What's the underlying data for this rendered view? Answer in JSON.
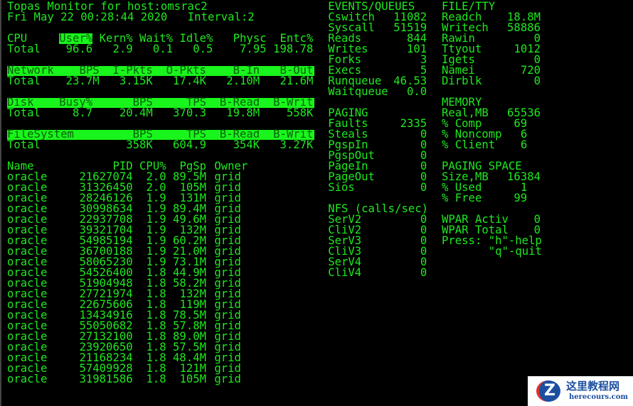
{
  "header": {
    "title": "Topas Monitor for host:omsrac2",
    "datetime": "Fri May 22 00:28:44 2020",
    "interval": "Interval:2"
  },
  "cpu": {
    "label": "CPU",
    "headers": [
      "User%",
      "Kern%",
      "Wait%",
      "Idle%",
      "Physc",
      "Entc%"
    ],
    "total_label": "Total",
    "values": [
      "96.6",
      "2.9",
      "0.1",
      "0.5",
      "7.95",
      "198.78"
    ]
  },
  "network": {
    "label": "Network",
    "headers": [
      "BPS",
      "I-Pkts",
      "O-Pkts",
      "B-In",
      "B-Out"
    ],
    "total_label": "Total",
    "values": [
      "23.7M",
      "3.15K",
      "17.4K",
      "2.10M",
      "21.6M"
    ]
  },
  "disk": {
    "label": "Disk",
    "headers": [
      "Busy%",
      "BPS",
      "TPS",
      "B-Read",
      "B-Writ"
    ],
    "total_label": "Total",
    "values": [
      "8.7",
      "20.4M",
      "370.3",
      "19.8M",
      "558K"
    ]
  },
  "filesystem": {
    "label": "FileSystem",
    "headers": [
      "BPS",
      "TPS",
      "B-Read",
      "B-Writ"
    ],
    "total_label": "Total",
    "values": [
      "358K",
      "604.9",
      "354K",
      "3.27K"
    ]
  },
  "processes": {
    "headers": [
      "Name",
      "PID",
      "CPU%",
      "PgSp",
      "Owner"
    ],
    "rows": [
      [
        "oracle",
        "21627074",
        "2.0",
        "89.5M",
        "grid"
      ],
      [
        "oracle",
        "31326450",
        "2.0",
        "105M",
        "grid"
      ],
      [
        "oracle",
        "28246126",
        "1.9",
        "131M",
        "grid"
      ],
      [
        "oracle",
        "30998634",
        "1.9",
        "89.4M",
        "grid"
      ],
      [
        "oracle",
        "22937708",
        "1.9",
        "49.6M",
        "grid"
      ],
      [
        "oracle",
        "39321704",
        "1.9",
        "132M",
        "grid"
      ],
      [
        "oracle",
        "54985194",
        "1.9",
        "60.2M",
        "grid"
      ],
      [
        "oracle",
        "36700188",
        "1.9",
        "21.0M",
        "grid"
      ],
      [
        "oracle",
        "58065230",
        "1.9",
        "73.1M",
        "grid"
      ],
      [
        "oracle",
        "54526400",
        "1.8",
        "44.9M",
        "grid"
      ],
      [
        "oracle",
        "51904948",
        "1.8",
        "58.2M",
        "grid"
      ],
      [
        "oracle",
        "27721974",
        "1.8",
        "132M",
        "grid"
      ],
      [
        "oracle",
        "22675606",
        "1.8",
        "119M",
        "grid"
      ],
      [
        "oracle",
        "13434916",
        "1.8",
        "78.5M",
        "grid"
      ],
      [
        "oracle",
        "55050682",
        "1.8",
        "57.8M",
        "grid"
      ],
      [
        "oracle",
        "27132100",
        "1.8",
        "89.0M",
        "grid"
      ],
      [
        "oracle",
        "23920650",
        "1.8",
        "57.5M",
        "grid"
      ],
      [
        "oracle",
        "21168234",
        "1.8",
        "48.4M",
        "grid"
      ],
      [
        "oracle",
        "57409928",
        "1.8",
        "121M",
        "grid"
      ],
      [
        "oracle",
        "31981586",
        "1.8",
        "105M",
        "grid"
      ]
    ]
  },
  "events": {
    "title": "EVENTS/QUEUES",
    "items": [
      [
        "Cswitch",
        "11082"
      ],
      [
        "Syscall",
        "51519"
      ],
      [
        "Reads",
        "844"
      ],
      [
        "Writes",
        "101"
      ],
      [
        "Forks",
        "3"
      ],
      [
        "Execs",
        "5"
      ],
      [
        "Runqueue",
        "46.53"
      ],
      [
        "Waitqueue",
        "0.0"
      ]
    ]
  },
  "paging": {
    "title": "PAGING",
    "items": [
      [
        "Faults",
        "2335"
      ],
      [
        "Steals",
        "0"
      ],
      [
        "PgspIn",
        "0"
      ],
      [
        "PgspOut",
        "0"
      ],
      [
        "PageIn",
        "0"
      ],
      [
        "PageOut",
        "0"
      ],
      [
        "Sios",
        "0"
      ]
    ]
  },
  "nfs": {
    "title": "NFS (calls/sec)",
    "items": [
      [
        "SerV2",
        "0"
      ],
      [
        "CliV2",
        "0"
      ],
      [
        "SerV3",
        "0"
      ],
      [
        "CliV3",
        "0"
      ],
      [
        "SerV4",
        "0"
      ],
      [
        "CliV4",
        "0"
      ]
    ]
  },
  "filetty": {
    "title": "FILE/TTY",
    "items": [
      [
        "Readch",
        "18.8M"
      ],
      [
        "Writech",
        "58886"
      ],
      [
        "Rawin",
        "0"
      ],
      [
        "Ttyout",
        "1012"
      ],
      [
        "Igets",
        "0"
      ],
      [
        "Namei",
        "720"
      ],
      [
        "Dirblk",
        "0"
      ]
    ]
  },
  "memory": {
    "title": "MEMORY",
    "items": [
      [
        "Real,MB",
        "65536"
      ],
      [
        "% Comp",
        "69"
      ],
      [
        "% Noncomp",
        "6"
      ],
      [
        "% Client",
        "6"
      ]
    ]
  },
  "paging_space": {
    "title": "PAGING SPACE",
    "items": [
      [
        "Size,MB",
        "16384"
      ],
      [
        "% Used",
        "1"
      ],
      [
        "% Free",
        "99"
      ]
    ]
  },
  "wpar": {
    "items": [
      [
        "WPAR Activ",
        "0"
      ],
      [
        "WPAR Total",
        "0"
      ]
    ]
  },
  "help": {
    "line1": "Press: \"h\"-help",
    "line2": "\"q\"-quit"
  },
  "watermark": {
    "cn": "这里教程网",
    "en": "herecours.com"
  },
  "colors": {
    "fg": "#1fe81f",
    "highlight": "#19f51c",
    "bg": "#000000"
  }
}
